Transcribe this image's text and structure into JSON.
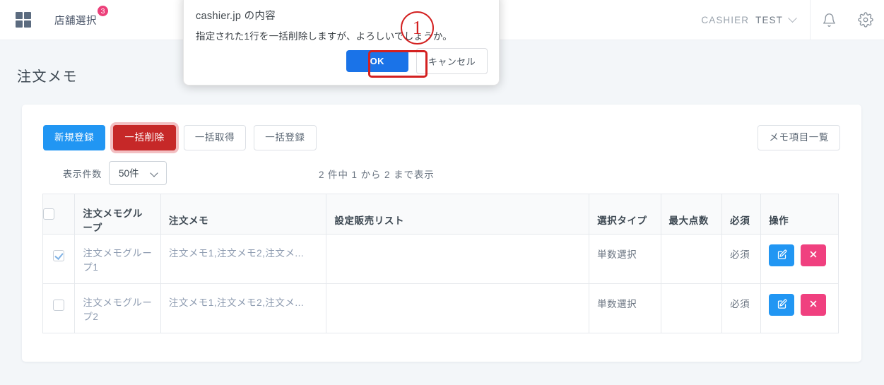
{
  "header": {
    "grid_icon": "grid-icon",
    "store_label": "店舗選択",
    "store_badge": "3",
    "user_org": "CASHIER",
    "user_name": "TEST",
    "chevron_icon": "chevron-down-icon",
    "bell_icon": "bell-icon",
    "gear_icon": "gear-icon"
  },
  "page": {
    "title": "注文メモ"
  },
  "toolbar": {
    "new_label": "新規登録",
    "bulk_delete_label": "一括削除",
    "bulk_fetch_label": "一括取得",
    "bulk_register_label": "一括登録",
    "memo_items_label": "メモ項目一覧"
  },
  "subbar": {
    "length_label": "表示件数",
    "length_value": "50件",
    "length_options": [
      "50件"
    ],
    "count_info": "2 件中 1 から 2 まで表示"
  },
  "table": {
    "columns": [
      {
        "key": "check",
        "label": ""
      },
      {
        "key": "group",
        "label": "注文メモグループ"
      },
      {
        "key": "memo",
        "label": "注文メモ"
      },
      {
        "key": "sales",
        "label": "設定販売リスト"
      },
      {
        "key": "type",
        "label": "選択タイプ"
      },
      {
        "key": "max",
        "label": "最大点数"
      },
      {
        "key": "req",
        "label": "必須"
      },
      {
        "key": "ops",
        "label": "操作"
      }
    ],
    "header_checkbox_checked": false,
    "rows": [
      {
        "checked": true,
        "group": "注文メモグループ1",
        "memo": "注文メモ1,注文メモ2,注文メ...",
        "sales": "",
        "type": "単数選択",
        "max": "",
        "req": "必須",
        "edit_icon": "edit-pencil-icon",
        "delete_icon": "close-x-icon"
      },
      {
        "checked": false,
        "group": "注文メモグループ2",
        "memo": "注文メモ1,注文メモ2,注文メ...",
        "sales": "",
        "type": "単数選択",
        "max": "",
        "req": "必須",
        "edit_icon": "edit-pencil-icon",
        "delete_icon": "close-x-icon"
      }
    ]
  },
  "dialog": {
    "title": "cashier.jp の内容",
    "message": "指定された1行を一括削除しますが、よろしいでしょうか。",
    "ok_label": "OK",
    "cancel_label": "キャンセル"
  },
  "annotation": {
    "step_number": "①"
  },
  "colors": {
    "primary": "#2196f3",
    "danger": "#c62828",
    "delete_pink": "#f0407f",
    "badge_pink": "#ec407a",
    "dialog_blue": "#1a73e8",
    "highlight_red": "#d32020",
    "page_bg": "#f3f6f9"
  }
}
